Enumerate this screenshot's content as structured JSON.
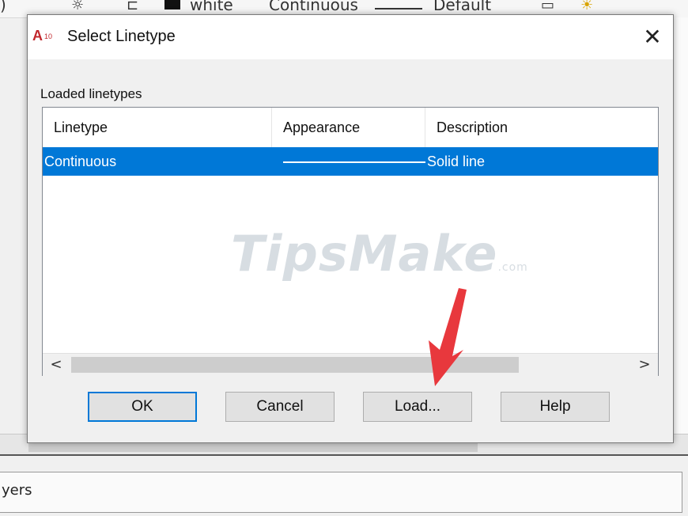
{
  "background": {
    "toolbar_items": [
      "white",
      "Continuous",
      "Default"
    ],
    "panel_label": "yers"
  },
  "dialog": {
    "title": "Select Linetype",
    "close_glyph": "✕",
    "app_icon_letter": "A",
    "app_icon_version": "10",
    "group_label": "Loaded linetypes",
    "columns": [
      "Linetype",
      "Appearance",
      "Description"
    ],
    "rows": [
      {
        "linetype": "Continuous",
        "description": "Solid line",
        "selected": true
      }
    ],
    "watermark": {
      "main": "TipsMake",
      "suffix": ".com"
    },
    "scroll": {
      "left": "<",
      "right": ">"
    },
    "buttons": {
      "ok": "OK",
      "cancel": "Cancel",
      "load": "Load...",
      "help": "Help"
    }
  },
  "colors": {
    "selection": "#0078d7",
    "annotation_arrow": "#e8383d",
    "app_icon": "#c1272d"
  }
}
